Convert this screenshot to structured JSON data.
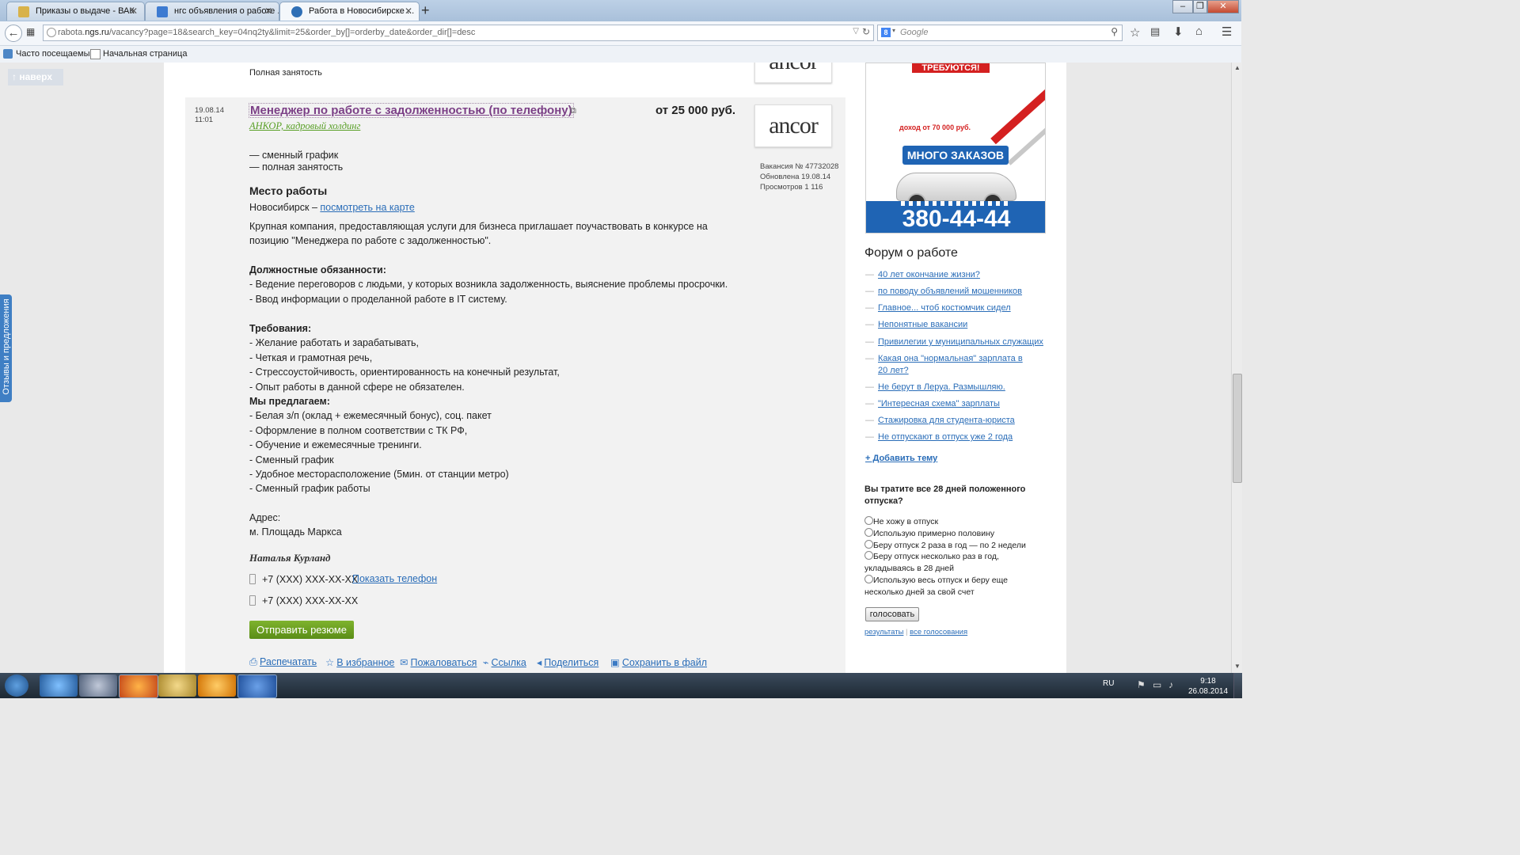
{
  "browser": {
    "tabs": [
      {
        "title": "Приказы о выдаче - ВАК",
        "active": false
      },
      {
        "title": "нгс объявления о работе ...",
        "active": false
      },
      {
        "title": "Работа в Новосибирске ...",
        "active": true
      }
    ],
    "new_tab": "+",
    "url_prefix": "rabota.",
    "url_domain": "ngs.ru",
    "url_rest": "/vacancy?page=18&search_key=04nq2ty&limit=25&order_by[]=orderby_date&order_dir[]=desc",
    "search_placeholder": "Google",
    "bookmarks": [
      "Часто посещаемые",
      "Начальная страница"
    ]
  },
  "page": {
    "up_button": "↑ наверх",
    "feedback_tab": "Отзывы и предложения",
    "prev_item_text": "Полная занятость",
    "prev_logo": "ancor",
    "vacancy": {
      "date": "19.08.14",
      "time": "11:01",
      "title": "Менеджер по работе с задолженностью (по телефону)",
      "company": "АНКОР, кадровый холдинг",
      "salary": "от 25 000 руб.",
      "logo": "ancor",
      "meta": [
        "Вакансия № 47732028",
        "Обновлена 19.08.14",
        "Просмотров 1 116"
      ],
      "schedule": [
        "— сменный график",
        "— полная занятость"
      ],
      "workplace_heading": "Место работы",
      "city": "Новосибирск – ",
      "map_link": "посмотреть на карте",
      "description": [
        "Крупная компания, предоставляющая услуги для бизнеса приглашает поучаствовать в конкурсе на",
        "позицию \"Менеджера по работе с задолженностью\"."
      ],
      "duties_heading": "Должностные обязанности:",
      "duties": [
        "- Ведение переговоров с людьми, у которых возникла задолженность, выяснение проблемы просрочки.",
        "- Ввод информации о проделанной работе в IT систему."
      ],
      "requirements_heading": "Требования:",
      "requirements": [
        "- Желание работать и зарабатывать,",
        "- Четкая и грамотная речь,",
        "- Стрессоустойчивость, ориентированность на конечный результат,",
        "- Опыт работы в данной сфере не обязателен."
      ],
      "offer_heading": "Мы предлагаем:",
      "offers": [
        "- Белая з/п (оклад + ежемесячный бонус), соц. пакет",
        "- Оформление в полном соответствии с ТК РФ,",
        "- Обучение и ежемесячные тренинги.",
        "- Сменный график",
        "- Удобное месторасположение (5мин. от станции метро)",
        "- Сменный график работы"
      ],
      "address_label": "Адрес:",
      "address": "м. Площадь Маркса",
      "contact_name": "Наталья Курланд",
      "phone1": "+7 (XXX) XXX-XX-XX",
      "show_phone": "Показать телефон",
      "phone2": "+7 (XXX) XXX-XX-XX",
      "send_resume": "Отправить резюме",
      "actions": [
        "Распечатать",
        "В избранное",
        "Пожаловаться",
        "Ссылка",
        "Поделиться",
        "Сохранить в файл"
      ]
    }
  },
  "sidebar": {
    "banner": {
      "top_text": "ТРЕБУЮТСЯ!",
      "income": "доход от 70 000 руб.",
      "orders": "МНОГО ЗАКАЗОВ",
      "phone": "380-44-44"
    },
    "forum_title": "Форум о работе",
    "forum_topics": [
      "40 лет окончание жизни?",
      "по поводу объявлений мошенников",
      "Главное... чтоб костюмчик сидел",
      "Непонятные вакансии",
      "Привилегии у муниципальных служащих",
      "Какая она \"нормальная\" зарплата в 20 лет?",
      "Не берут в Леруа. Размышляю.",
      "\"Интересная схема\" зарплаты",
      "Стажировка для студента-юриста",
      "Не отпускают в отпуск уже 2 года"
    ],
    "add_topic": "+ Добавить тему",
    "poll_question": "Вы тратите все 28 дней положенного отпуска?",
    "poll_options": [
      "Не хожу в отпуск",
      "Использую примерно половину",
      "Беру отпуск 2 раза в год — по 2 недели",
      "Беру отпуск несколько раз в год, укладываясь в 28 дней",
      "Использую весь отпуск и беру еще несколько дней за свой счет"
    ],
    "vote_button": "голосовать",
    "results_link": "результаты",
    "all_polls_link": "все голосования"
  },
  "taskbar": {
    "lang": "RU",
    "time": "9:18",
    "date": "26.08.2014"
  },
  "colors": {
    "link": "#2a6db8",
    "visited_title": "#7b3f86",
    "green_button": "#6aa021",
    "banner_blue": "#1f64b4",
    "banner_red": "#d42020"
  }
}
